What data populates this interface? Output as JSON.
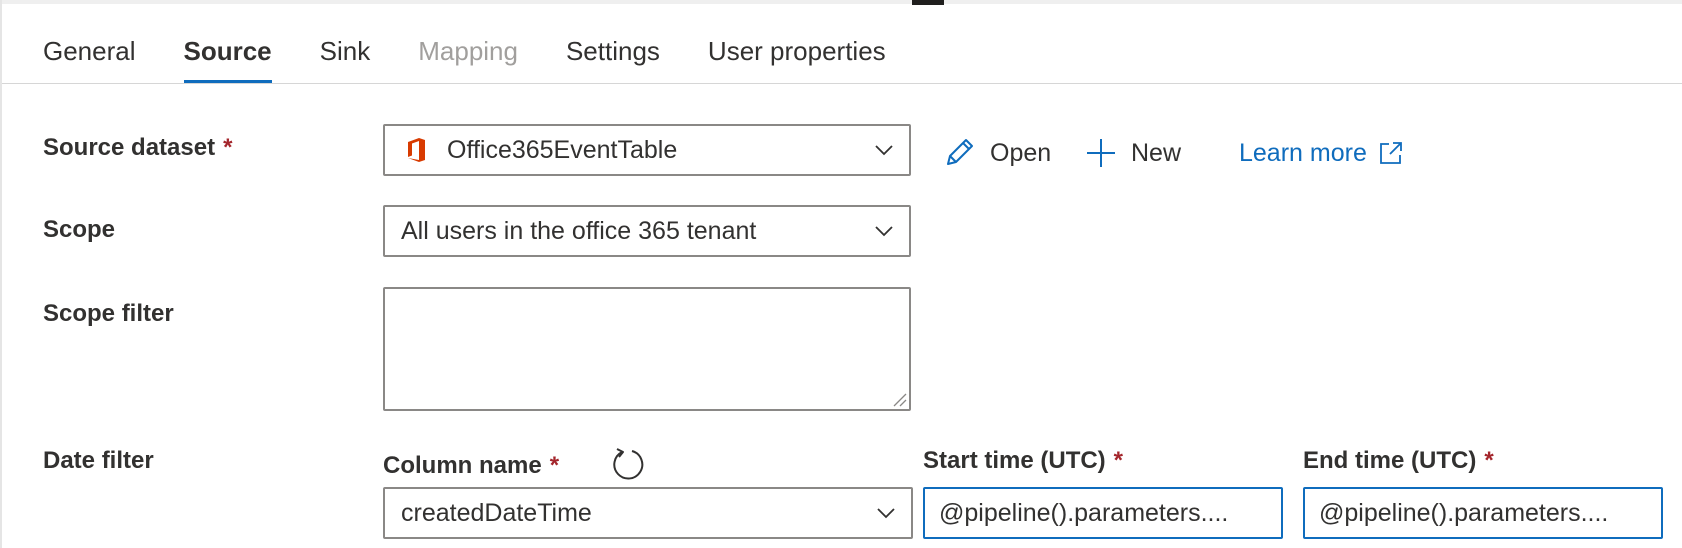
{
  "tabs": [
    {
      "label": "General",
      "state": "normal"
    },
    {
      "label": "Source",
      "state": "active"
    },
    {
      "label": "Sink",
      "state": "normal"
    },
    {
      "label": "Mapping",
      "state": "disabled"
    },
    {
      "label": "Settings",
      "state": "normal"
    },
    {
      "label": "User properties",
      "state": "normal"
    }
  ],
  "source_dataset": {
    "label": "Source dataset",
    "required_mark": "*",
    "value": "Office365EventTable",
    "icon": "office-365-icon",
    "icon_color": "#d83b01"
  },
  "actions": {
    "open_label": "Open",
    "new_label": "New",
    "learn_more_label": "Learn more"
  },
  "scope": {
    "label": "Scope",
    "value": "All users in the office 365 tenant"
  },
  "scope_filter": {
    "label": "Scope filter",
    "value": ""
  },
  "date_filter": {
    "label": "Date filter",
    "column_name_label": "Column name",
    "column_name_value": "createdDateTime",
    "start_time_label": "Start time (UTC)",
    "start_time_value": "@pipeline().parameters....",
    "end_time_label": "End time (UTC)",
    "end_time_value": "@pipeline().parameters....",
    "required_mark": "*"
  },
  "colors": {
    "accent": "#0f6cbd",
    "required": "#a4262c",
    "disabled_text": "#a19f9d"
  }
}
